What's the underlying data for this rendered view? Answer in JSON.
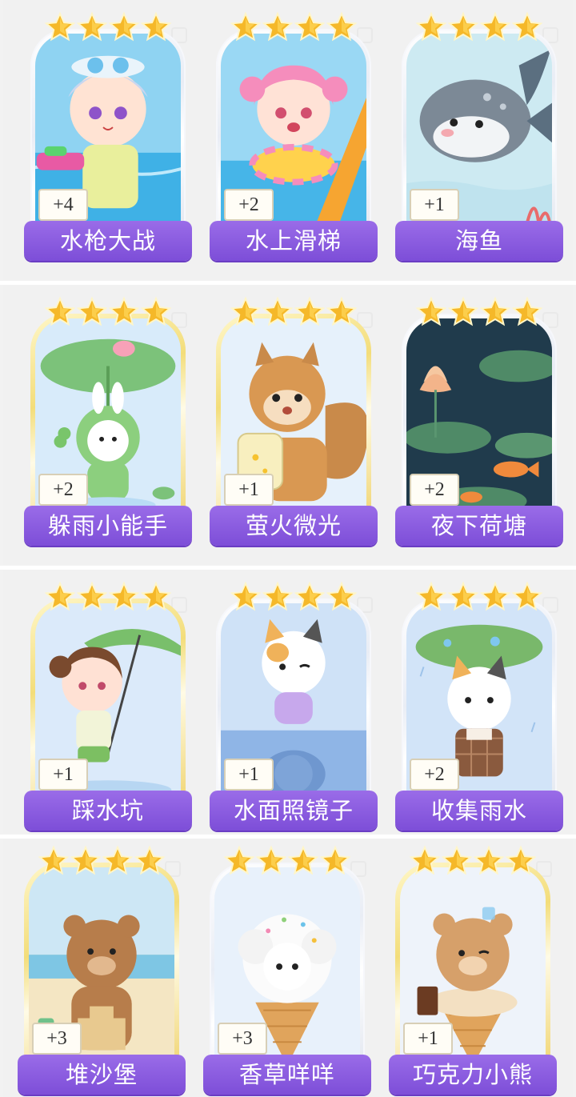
{
  "rows": [
    {
      "cards": [
        {
          "title": "水枪大战",
          "count": "+4",
          "stars": 4,
          "frame": "silver",
          "art": "water-gun-boy"
        },
        {
          "title": "水上滑梯",
          "count": "+2",
          "stars": 4,
          "frame": "silver",
          "art": "water-slide-girl"
        },
        {
          "title": "海鱼",
          "count": "+1",
          "stars": 4,
          "frame": "silver",
          "art": "sea-fish"
        }
      ]
    },
    {
      "cards": [
        {
          "title": "躲雨小能手",
          "count": "+2",
          "stars": 4,
          "frame": "gold",
          "art": "frog-bunny-leaf"
        },
        {
          "title": "萤火微光",
          "count": "+1",
          "stars": 4,
          "frame": "gold",
          "art": "squirrel-firefly"
        },
        {
          "title": "夜下荷塘",
          "count": "+2",
          "stars": 4,
          "frame": "silver",
          "art": "lotus-pond"
        }
      ]
    },
    {
      "cards": [
        {
          "title": "踩水坑",
          "count": "+1",
          "stars": 4,
          "frame": "gold",
          "art": "puddle-girl"
        },
        {
          "title": "水面照镜子",
          "count": "+1",
          "stars": 4,
          "frame": "silver",
          "art": "cat-reflection"
        },
        {
          "title": "收集雨水",
          "count": "+2",
          "stars": 4,
          "frame": "silver",
          "art": "cat-leaf-rain"
        }
      ]
    },
    {
      "cards": [
        {
          "title": "堆沙堡",
          "count": "+3",
          "stars": 4,
          "frame": "gold",
          "art": "bear-sandcastle"
        },
        {
          "title": "香草咩咩",
          "count": "+3",
          "stars": 4,
          "frame": "silver",
          "art": "sheep-icecream"
        },
        {
          "title": "巧克力小熊",
          "count": "+1",
          "stars": 4,
          "frame": "gold",
          "art": "bear-icecream"
        }
      ]
    }
  ],
  "colors": {
    "banner": "#8a5ce0",
    "star": "#f5b829",
    "page_bg": "#f2f2f2"
  }
}
